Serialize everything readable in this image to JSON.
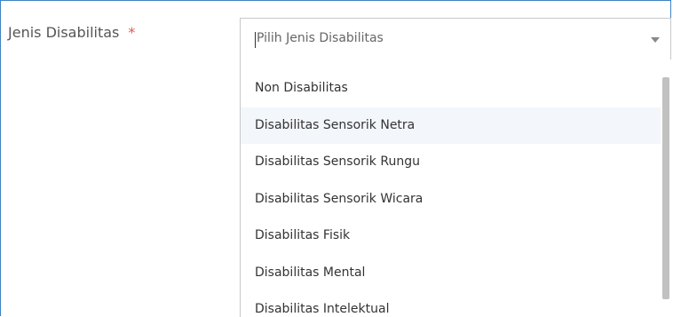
{
  "field": {
    "label": "Jenis Disabilitas",
    "required_mark": "*"
  },
  "select": {
    "placeholder": "Pilih Jenis Disabilitas",
    "icon": "chevron-down-icon"
  },
  "dropdown": {
    "options": [
      "Non Disabilitas",
      "Disabilitas Sensorik Netra",
      "Disabilitas Sensorik Rungu",
      "Disabilitas Sensorik Wicara",
      "Disabilitas Fisik",
      "Disabilitas Mental",
      "Disabilitas Intelektual"
    ],
    "highlighted_index": 1
  },
  "colors": {
    "focus_border": "#3c83c4",
    "required": "#e05a4f",
    "hover_bg": "#f3f6fa"
  }
}
